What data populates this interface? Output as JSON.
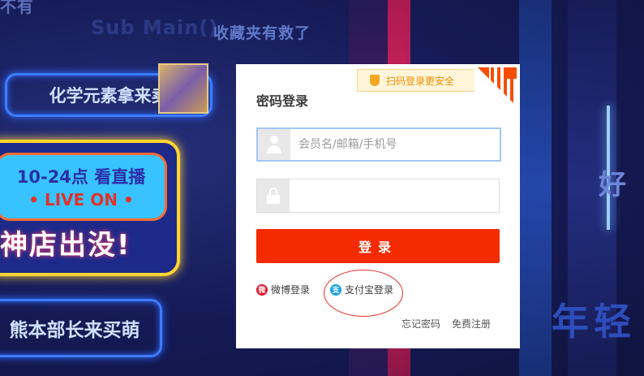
{
  "background": {
    "top_left_fragment": "不有",
    "submain_text": "Sub Main()",
    "tagline": "收藏夹有救了",
    "box1_label": "化学元素拿来卖",
    "box2_label": "熊本部长来买萌",
    "sign_line1": "10-24点 看直播",
    "sign_line2": "• LIVE ON •",
    "sign_line3": "神店出没!",
    "right_text": "年轻",
    "right_glyph": "好"
  },
  "login": {
    "qr_tip": "扫码登录更安全",
    "title": "密码登录",
    "username_placeholder": "会员名/邮箱/手机号",
    "username_value": "",
    "password_value": "",
    "submit_label": "登录",
    "weibo_label": "微博登录",
    "alipay_label": "支付宝登录",
    "forgot_label": "忘记密码",
    "register_label": "免费注册"
  },
  "colors": {
    "accent": "#f52b00",
    "qr_tip_text": "#f28c00",
    "annotation_circle": "#e0302a",
    "weibo": "#e6162d",
    "alipay": "#1aa1e6"
  },
  "icons": {
    "qr_tip": "shield-icon",
    "qr_corner": "qr-code-icon",
    "username": "user-icon",
    "password": "lock-icon",
    "weibo": "weibo-icon",
    "alipay": "alipay-icon"
  }
}
